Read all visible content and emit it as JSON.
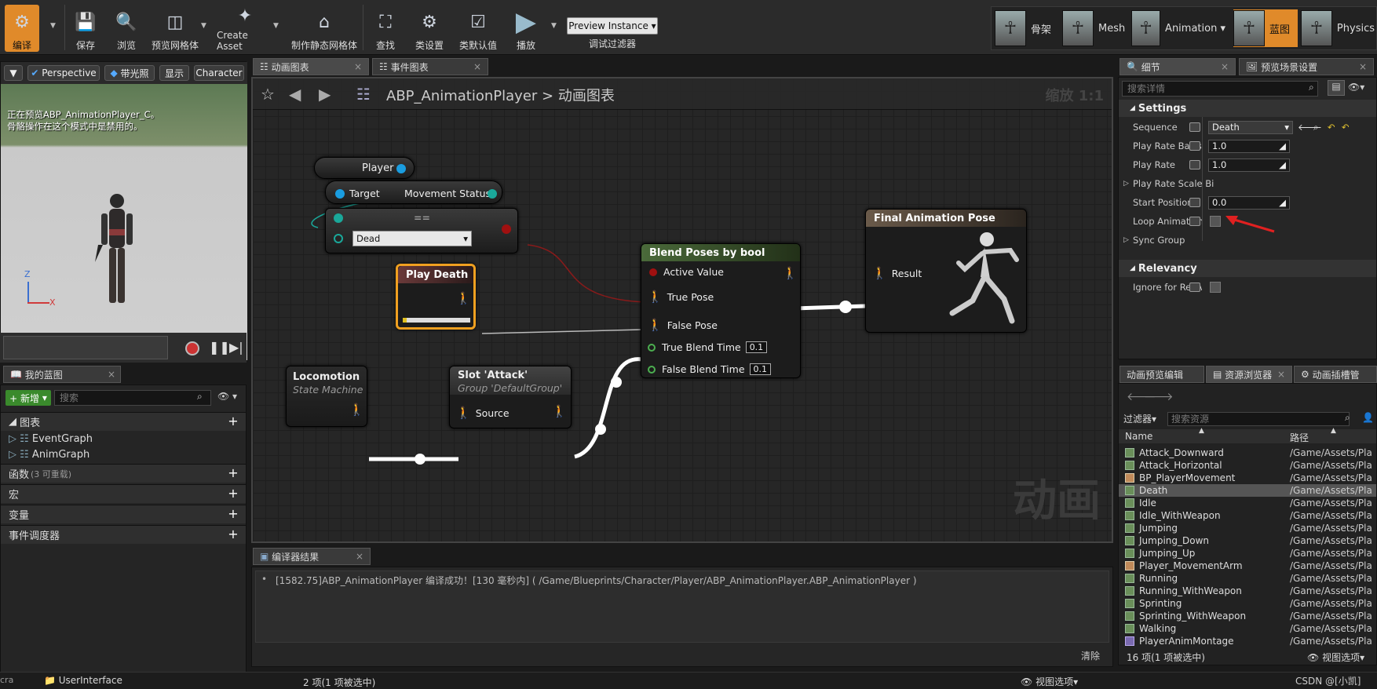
{
  "toolbar": {
    "items": [
      "编译",
      "保存",
      "浏览",
      "预览网格体",
      "Create Asset",
      "制作静态网格体",
      "查找",
      "类设置",
      "类默认值",
      "播放"
    ],
    "preview_instance": "Preview Instance",
    "debug_filter": "调试过滤器"
  },
  "modes": [
    "骨架",
    "Mesh",
    "Animation",
    "蓝图",
    "Physics"
  ],
  "viewport": {
    "chips": [
      "Perspective",
      "带光照",
      "显示",
      "Character"
    ],
    "message": "正在预览ABP_AnimationPlayer_C。\n骨骼操作在这个模式中是禁用的。",
    "axis_z": "Z",
    "axis_x": "X"
  },
  "my_blueprint": {
    "tab": "我的蓝图",
    "new": "+ 新增",
    "search_placeholder": "搜索",
    "graphs_label": "图表",
    "graphs": [
      "EventGraph",
      "AnimGraph"
    ],
    "functions_label": "函数",
    "functions_note": "(3 可重载)",
    "macros_label": "宏",
    "variables_label": "变量",
    "dispatchers_label": "事件调度器"
  },
  "graph_tabs": [
    "动画图表",
    "事件图表"
  ],
  "graph": {
    "breadcrumb_bp": "ABP_AnimationPlayer",
    "breadcrumb_sep": ">",
    "breadcrumb_graph": "动画图表",
    "zoom": "缩放 1:1",
    "watermark": "动画"
  },
  "nodes": {
    "player": "Player",
    "target": "Target",
    "movement_status": "Movement Status",
    "enum_dashes": "==",
    "enum_value": "Dead",
    "play_death": "Play Death",
    "blend_title": "Blend Poses by bool",
    "active_value": "Active Value",
    "true_pose": "True Pose",
    "false_pose": "False Pose",
    "true_blend": "True Blend Time",
    "true_blend_val": "0.1",
    "false_blend": "False Blend Time",
    "false_blend_val": "0.1",
    "final_title": "Final Animation Pose",
    "result": "Result",
    "loco_title": "Locomotion",
    "loco_sub": "State Machine",
    "slot_title": "Slot 'Attack'",
    "slot_sub": "Group 'DefaultGroup'",
    "source": "Source"
  },
  "details": {
    "tabs": [
      "细节",
      "预览场景设置"
    ],
    "search_placeholder": "搜索详情",
    "settings": "Settings",
    "relevancy": "Relevancy",
    "props": [
      {
        "label": "Sequence",
        "value": "Death"
      },
      {
        "label": "Play Rate Basis",
        "value": "1.0"
      },
      {
        "label": "Play Rate",
        "value": "1.0"
      },
      {
        "label": "Play Rate Scale Bi",
        "value": ""
      },
      {
        "label": "Start Position",
        "value": "0.0"
      },
      {
        "label": "Loop Animation",
        "value": ""
      },
      {
        "label": "Sync Group",
        "value": ""
      }
    ],
    "ignore_label": "Ignore for Relevancy"
  },
  "asset_browser": {
    "tabs": [
      "动画预览编辑",
      "资源浏览器",
      "动画插槽管"
    ],
    "filter": "过滤器",
    "search_placeholder": "搜索资源",
    "col_name": "Name",
    "col_path": "路径",
    "rows": [
      {
        "name": "Attack_Downward",
        "path": "/Game/Assets/Pla"
      },
      {
        "name": "Attack_Horizontal",
        "path": "/Game/Assets/Pla"
      },
      {
        "name": "BP_PlayerMovement",
        "path": "/Game/Assets/Pla"
      },
      {
        "name": "Death",
        "path": "/Game/Assets/Pla"
      },
      {
        "name": "Idle",
        "path": "/Game/Assets/Pla"
      },
      {
        "name": "Idle_WithWeapon",
        "path": "/Game/Assets/Pla"
      },
      {
        "name": "Jumping",
        "path": "/Game/Assets/Pla"
      },
      {
        "name": "Jumping_Down",
        "path": "/Game/Assets/Pla"
      },
      {
        "name": "Jumping_Up",
        "path": "/Game/Assets/Pla"
      },
      {
        "name": "Player_MovementArm",
        "path": "/Game/Assets/Pla"
      },
      {
        "name": "Running",
        "path": "/Game/Assets/Pla"
      },
      {
        "name": "Running_WithWeapon",
        "path": "/Game/Assets/Pla"
      },
      {
        "name": "Sprinting",
        "path": "/Game/Assets/Pla"
      },
      {
        "name": "Sprinting_WithWeapon",
        "path": "/Game/Assets/Pla"
      },
      {
        "name": "Walking",
        "path": "/Game/Assets/Pla"
      },
      {
        "name": "PlayerAnimMontage",
        "path": "/Game/Assets/Pla"
      }
    ],
    "count": "16 项(1 项被选中)",
    "view_options": "视图选项"
  },
  "compiler": {
    "tab": "编译器结果",
    "message": "[1582.75]ABP_AnimationPlayer 编译成功！[130 毫秒内] ( /Game/Blueprints/Character/Player/ABP_AnimationPlayer.ABP_AnimationPlayer )",
    "clear": "清除"
  },
  "status": {
    "folder": "UserInterface",
    "count": "2 项(1 项被选中)",
    "view_options": "视图选项",
    "credit": "CSDN @[小凯]",
    "left": "cra"
  }
}
